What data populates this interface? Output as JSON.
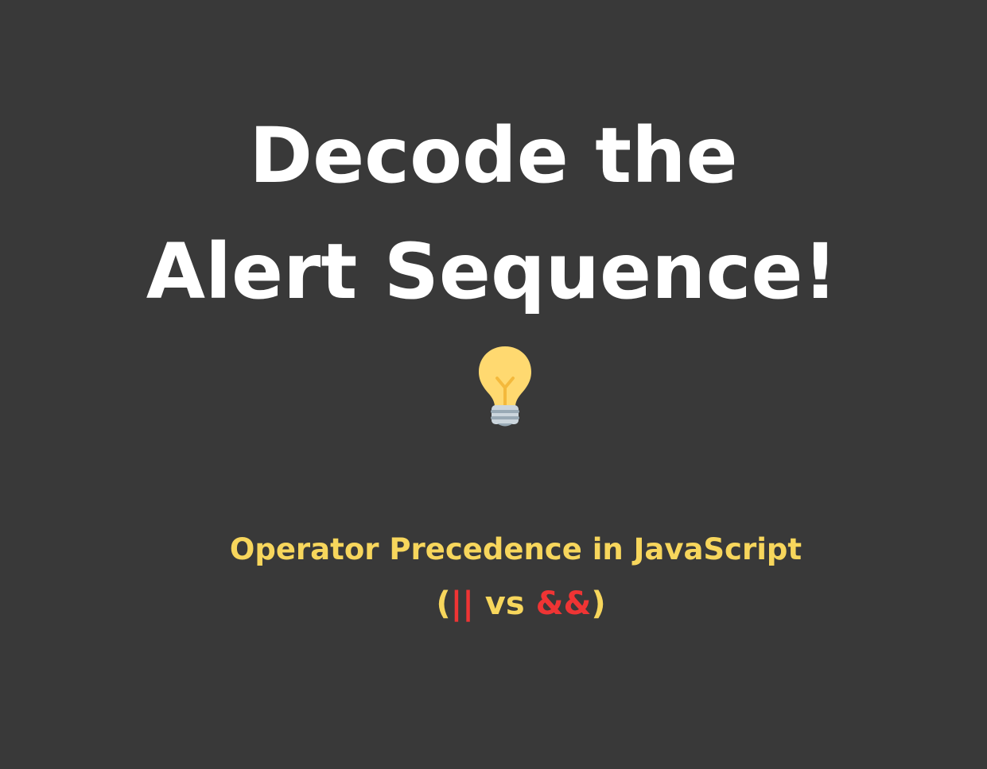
{
  "title": {
    "line1": "Decode the",
    "line2": "Alert Sequence!"
  },
  "icon": "lightbulb-icon",
  "subtitle": "Operator Precedence in JavaScript",
  "operators": {
    "open_paren": "(",
    "or_op": "||",
    "vs": " vs ",
    "and_op": "&&",
    "close_paren": ")"
  },
  "colors": {
    "background": "#393939",
    "title": "#ffffff",
    "accent_yellow": "#f7d65c",
    "accent_red": "#ef3434"
  }
}
